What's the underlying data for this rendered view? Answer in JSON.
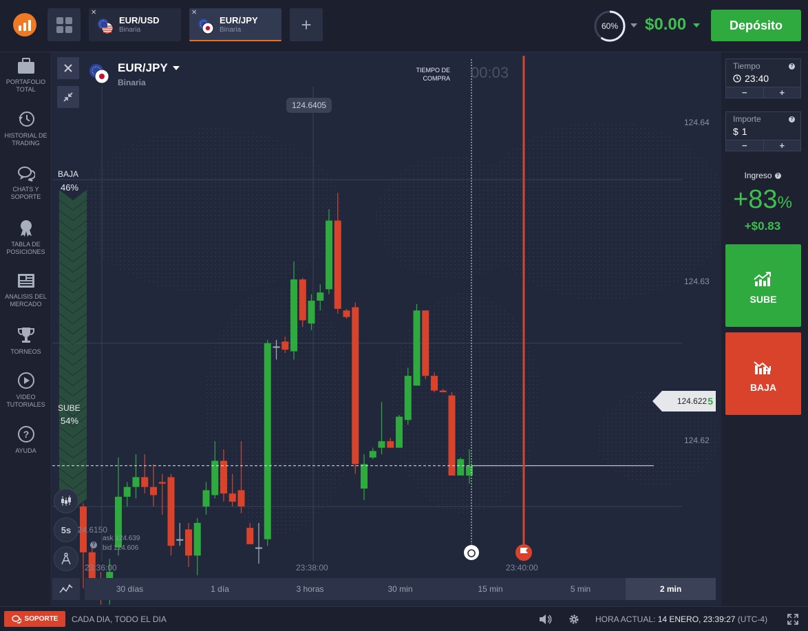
{
  "header": {
    "tabs": [
      {
        "name": "EUR/USD",
        "type": "Binaria",
        "active": false
      },
      {
        "name": "EUR/JPY",
        "type": "Binaria",
        "active": true
      }
    ],
    "gauge_percent": "60%",
    "gauge_value": 0.6,
    "balance": "$0.00",
    "deposit_label": "Depósito"
  },
  "sidebar": {
    "items": [
      {
        "label": "PORTAFOLIO TOTAL",
        "icon": "briefcase-icon"
      },
      {
        "label": "HISTORIAL DE TRADING",
        "icon": "history-icon"
      },
      {
        "label": "CHATS Y SOPORTE",
        "icon": "chat-icon"
      },
      {
        "label": "TABLA DE POSICIONES",
        "icon": "medal-icon"
      },
      {
        "label": "ANALISIS DEL MERCADO",
        "icon": "newspaper-icon"
      },
      {
        "label": "TORNEOS",
        "icon": "trophy-icon"
      },
      {
        "label": "VIDEO TUTORIALES",
        "icon": "play-icon"
      },
      {
        "label": "AYUDA",
        "icon": "help-icon"
      }
    ]
  },
  "chart": {
    "asset_name": "EUR/JPY",
    "asset_type": "Binaria",
    "sentiment": {
      "down_label": "BAJA",
      "down_pct": "46%",
      "up_label": "SUBE",
      "up_pct": "54%",
      "down_value": 0.46,
      "up_value": 0.54
    },
    "buy_time_label": "TIEMPO DE COMPRA",
    "countdown": "00:03",
    "high_tag": "124.6405",
    "low_tag": "124.6150",
    "current_price_main": "124.622",
    "current_price_last": "5",
    "ask": "ask 124.639",
    "bid": "bid 124.606",
    "interval_label": "5s",
    "y_axis_labels": [
      "124.64",
      "124.63",
      "124.62"
    ],
    "x_axis_labels": [
      "23:36:00",
      "23:38:00",
      "23:40:00"
    ],
    "timeframes": [
      "30 días",
      "1 día",
      "3 horas",
      "30 min",
      "15 min",
      "5 min",
      "2 min"
    ],
    "selected_timeframe": "2 min"
  },
  "chart_data": {
    "type": "candlestick",
    "y_range": [
      124.6139,
      124.6478
    ],
    "y_ticks": [
      124.64,
      124.63,
      124.62
    ],
    "x_ticks": [
      "23:36:00",
      "23:38:00",
      "23:40:00"
    ],
    "current_price": 124.6225,
    "purchase_deadline": "23:39:30",
    "expiration": "23:40:00",
    "candles": [
      {
        "o": 124.62,
        "c": 124.6172,
        "h": 124.6202,
        "l": 124.615
      },
      {
        "o": 124.6172,
        "c": 124.6152,
        "h": 124.6175,
        "l": 124.6145
      },
      {
        "o": 124.6152,
        "c": 124.6147,
        "h": 124.616,
        "l": 124.614
      },
      {
        "o": 124.6145,
        "c": 124.616,
        "h": 124.6168,
        "l": 124.614
      },
      {
        "o": 124.6175,
        "c": 124.6206,
        "h": 124.623,
        "l": 124.617
      },
      {
        "o": 124.6206,
        "c": 124.6212,
        "h": 124.6215,
        "l": 124.62
      },
      {
        "o": 124.6212,
        "c": 124.6218,
        "h": 124.6232,
        "l": 124.6205
      },
      {
        "o": 124.6218,
        "c": 124.6212,
        "h": 124.6232,
        "l": 124.6208
      },
      {
        "o": 124.6212,
        "c": 124.6207,
        "h": 124.6226,
        "l": 124.62
      },
      {
        "o": 124.6215,
        "c": 124.6214,
        "h": 124.622,
        "l": 124.6195
      },
      {
        "o": 124.6218,
        "c": 124.6176,
        "h": 124.622,
        "l": 124.617
      },
      {
        "o": 124.618,
        "c": 124.618,
        "h": 124.619,
        "l": 124.6176
      },
      {
        "o": 124.6186,
        "c": 124.617,
        "h": 124.619,
        "l": 124.6163
      },
      {
        "o": 124.617,
        "c": 124.619,
        "h": 124.6193,
        "l": 124.6158
      },
      {
        "o": 124.62,
        "c": 124.621,
        "h": 124.6215,
        "l": 124.6195
      },
      {
        "o": 124.6207,
        "c": 124.6228,
        "h": 124.624,
        "l": 124.6205
      },
      {
        "o": 124.6228,
        "c": 124.6208,
        "h": 124.6235,
        "l": 124.6203
      },
      {
        "o": 124.6208,
        "c": 124.6203,
        "h": 124.622,
        "l": 124.62
      },
      {
        "o": 124.621,
        "c": 124.62,
        "h": 124.624,
        "l": 124.6196
      },
      {
        "o": 124.6187,
        "c": 124.6177,
        "h": 124.619,
        "l": 124.6177
      },
      {
        "o": 124.6175,
        "c": 124.6175,
        "h": 124.619,
        "l": 124.6165
      },
      {
        "o": 124.618,
        "c": 124.63,
        "h": 124.6302,
        "l": 124.6176
      },
      {
        "o": 124.6298,
        "c": 124.6298,
        "h": 124.6302,
        "l": 124.629
      },
      {
        "o": 124.6301,
        "c": 124.6296,
        "h": 124.6304,
        "l": 124.6294
      },
      {
        "o": 124.6295,
        "c": 124.6339,
        "h": 124.635,
        "l": 124.629
      },
      {
        "o": 124.6339,
        "c": 124.6314,
        "h": 124.634,
        "l": 124.631
      },
      {
        "o": 124.6312,
        "c": 124.6326,
        "h": 124.633,
        "l": 124.6308
      },
      {
        "o": 124.6326,
        "c": 124.6331,
        "h": 124.6336,
        "l": 124.632
      },
      {
        "o": 124.6333,
        "c": 124.6375,
        "h": 124.6382,
        "l": 124.633
      },
      {
        "o": 124.6375,
        "c": 124.6321,
        "h": 124.6392,
        "l": 124.6318
      },
      {
        "o": 124.632,
        "c": 124.6316,
        "h": 124.6321,
        "l": 124.6315
      },
      {
        "o": 124.6322,
        "c": 124.6226,
        "h": 124.6325,
        "l": 124.622
      },
      {
        "o": 124.6211,
        "c": 124.6226,
        "h": 124.6232,
        "l": 124.6204
      },
      {
        "o": 124.623,
        "c": 124.6234,
        "h": 124.6236,
        "l": 124.6229
      },
      {
        "o": 124.6236,
        "c": 124.624,
        "h": 124.6264,
        "l": 124.6232
      },
      {
        "o": 124.624,
        "c": 124.6236,
        "h": 124.6242,
        "l": 124.6236
      },
      {
        "o": 124.6236,
        "c": 124.6255,
        "h": 124.6256,
        "l": 124.6236
      },
      {
        "o": 124.6253,
        "c": 124.628,
        "h": 124.6285,
        "l": 124.625
      },
      {
        "o": 124.6274,
        "c": 124.632,
        "h": 124.6324,
        "l": 124.6274
      },
      {
        "o": 124.632,
        "c": 124.628,
        "h": 124.632,
        "l": 124.6278
      },
      {
        "o": 124.628,
        "c": 124.6271,
        "h": 124.6282,
        "l": 124.627
      },
      {
        "o": 124.6271,
        "c": 124.627,
        "h": 124.6272,
        "l": 124.627
      },
      {
        "o": 124.6268,
        "c": 124.6219,
        "h": 124.627,
        "l": 124.6219
      },
      {
        "o": 124.6219,
        "c": 124.6229,
        "h": 124.623,
        "l": 124.6219
      },
      {
        "o": 124.6219,
        "c": 124.6225,
        "h": 124.6235,
        "l": 124.6214
      }
    ]
  },
  "right_panel": {
    "time_label": "Tiempo",
    "time_value": "23:40",
    "amount_label": "Importe",
    "amount_currency": "$",
    "amount_value": "1",
    "minus": "−",
    "plus": "+",
    "income_label": "Ingreso",
    "income_pct": "+83",
    "income_pct_sign": "%",
    "income_amount": "+$0.83",
    "call_label": "SUBE",
    "put_label": "BAJA"
  },
  "footer": {
    "support_label": "SOPORTE",
    "tagline": "CADA DIA, TODO EL DIA",
    "clock_label": "HORA ACTUAL:",
    "clock_value": "14 ENERO, 23:39:27",
    "timezone": "(UTC-4)"
  },
  "colors": {
    "up": "#2faa3f",
    "down": "#d9432c",
    "accent": "#e8702a",
    "background": "#22283c"
  }
}
